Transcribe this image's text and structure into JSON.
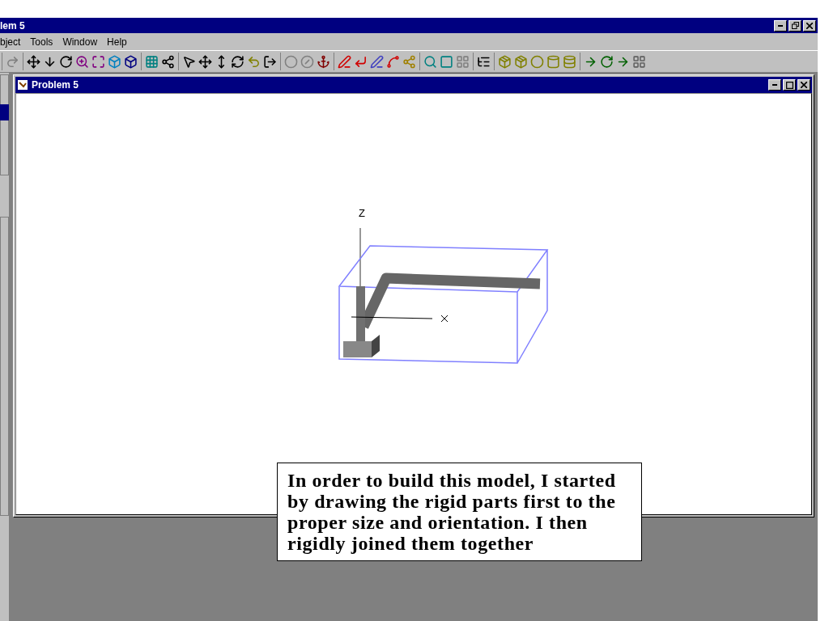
{
  "app_window": {
    "title": "lem 5"
  },
  "menu": [
    "bject",
    "Tools",
    "Window",
    "Help"
  ],
  "document_window": {
    "title": "Problem 5",
    "axis_label": "Z"
  },
  "callout": {
    "text": "In order to build this model, I started by drawing the rigid parts first to the proper size and orientation.  I then rigidly joined them together"
  }
}
